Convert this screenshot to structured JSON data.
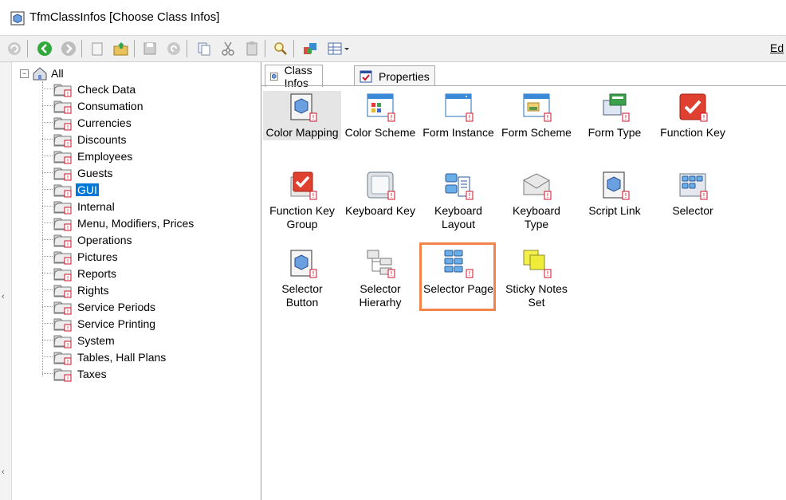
{
  "window": {
    "title": "TfmClassInfos [Choose Class Infos]"
  },
  "toolbar": {
    "buttons": [
      "refresh-icon",
      "back-icon",
      "forward-icon",
      "new-icon",
      "open-icon",
      "save-icon",
      "undo-icon",
      "copy-icon",
      "cut-icon",
      "paste-icon",
      "search-icon",
      "tools-icon",
      "grid-view-icon"
    ],
    "edit_menu": "Ed"
  },
  "tree": {
    "root_label": "All",
    "items": [
      {
        "label": "Check Data"
      },
      {
        "label": "Consumation"
      },
      {
        "label": "Currencies"
      },
      {
        "label": "Discounts"
      },
      {
        "label": "Employees"
      },
      {
        "label": "Guests"
      },
      {
        "label": "GUI",
        "selected": true
      },
      {
        "label": "Internal"
      },
      {
        "label": "Menu, Modifiers, Prices"
      },
      {
        "label": "Operations"
      },
      {
        "label": "Pictures"
      },
      {
        "label": "Reports"
      },
      {
        "label": "Rights"
      },
      {
        "label": "Service Periods"
      },
      {
        "label": "Service Printing"
      },
      {
        "label": "System"
      },
      {
        "label": "Tables, Hall Plans"
      },
      {
        "label": "Taxes"
      }
    ]
  },
  "tabs": [
    {
      "label": "Class Infos",
      "active": true
    },
    {
      "label": "Properties",
      "active": false
    }
  ],
  "class_infos": [
    {
      "label": "Color Mapping",
      "icon": "color-mapping-icon"
    },
    {
      "label": "Color Scheme",
      "icon": "color-scheme-icon"
    },
    {
      "label": "Form Instance",
      "icon": "form-instance-icon"
    },
    {
      "label": "Form Scheme",
      "icon": "form-scheme-icon"
    },
    {
      "label": "Form Type",
      "icon": "form-type-icon"
    },
    {
      "label": "Function Key",
      "icon": "function-key-icon"
    },
    {
      "label": "Function Key\nGroup",
      "icon": "function-key-group-icon"
    },
    {
      "label": "Keyboard Key",
      "icon": "keyboard-key-icon"
    },
    {
      "label": "Keyboard\nLayout",
      "icon": "keyboard-layout-icon"
    },
    {
      "label": "Keyboard\nType",
      "icon": "keyboard-type-icon"
    },
    {
      "label": "Script Link",
      "icon": "script-link-icon"
    },
    {
      "label": "Selector",
      "icon": "selector-icon"
    },
    {
      "label": "Selector\nButton",
      "icon": "selector-button-icon"
    },
    {
      "label": "Selector\nHierarhy",
      "icon": "selector-hierarchy-icon"
    },
    {
      "label": "Selector Page",
      "icon": "selector-page-icon",
      "highlighted": true
    },
    {
      "label": "Sticky Notes\nSet",
      "icon": "sticky-notes-icon"
    }
  ],
  "colors": {
    "selection": "#0078d7",
    "highlight_border": "#f2844a",
    "hover_bg": "#e5e5e5",
    "badge_red": "#d0102a"
  }
}
